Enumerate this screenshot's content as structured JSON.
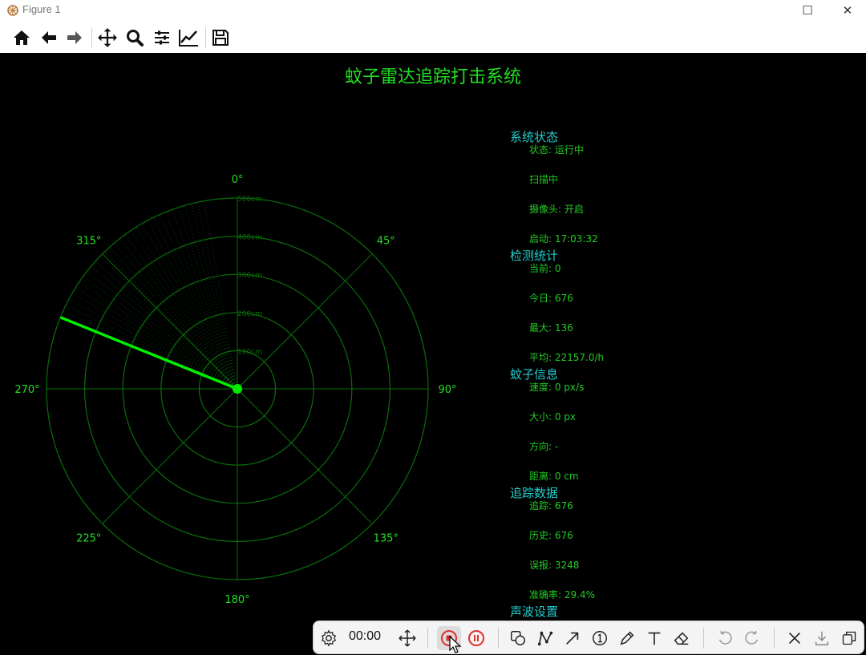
{
  "window": {
    "title": "Figure 1",
    "maximize_glyph": "☐",
    "close_glyph": "✕"
  },
  "toolbar": {
    "icons": [
      "home-icon",
      "back-arrow-icon",
      "forward-arrow-icon",
      "pan-icon",
      "zoom-icon",
      "configure-subplots-icon",
      "edit-axes-icon",
      "save-icon"
    ]
  },
  "figure": {
    "title": "蚊子雷达追踪打击系统",
    "radar": {
      "angle_labels": [
        "0°",
        "45°",
        "90°",
        "135°",
        "180°",
        "225°",
        "270°",
        "315°"
      ],
      "range_labels": [
        "100cm",
        "200cm",
        "300cm",
        "400cm",
        "500cm"
      ],
      "max_range_cm": 500,
      "sweep_angle_deg": 292,
      "sweep_trail_deg": 60,
      "colors": {
        "grid": "#0a6e0a",
        "sweep": "#00ee00",
        "label": "#22dd22"
      }
    }
  },
  "info": {
    "sections": [
      {
        "title": "系统状态",
        "items": [
          "状态: 运行中",
          "扫描中",
          "摄像头: 开启",
          "启动: 17:03:32"
        ]
      },
      {
        "title": "检测统计",
        "items": [
          "当前: 0",
          "今日: 676",
          "最大: 136",
          "平均: 22157.0/h"
        ]
      },
      {
        "title": "蚊子信息",
        "items": [
          "速度: 0 px/s",
          "大小: 0 px",
          "方向: -",
          "距离: 0 cm"
        ]
      },
      {
        "title": "追踪数据",
        "items": [
          "追踪: 676",
          "历史: 676",
          "误报: 3248",
          "准确率: 29.4%"
        ]
      },
      {
        "title": "声波设置",
        "items": []
      }
    ]
  },
  "rec_toolbar": {
    "timer": "00:00"
  }
}
